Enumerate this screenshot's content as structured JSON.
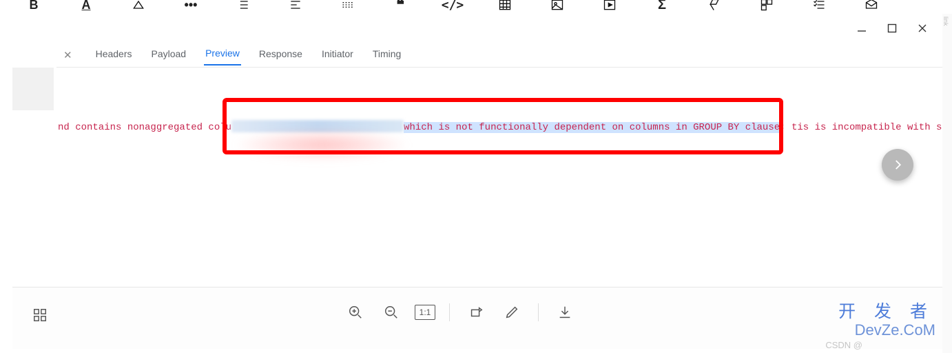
{
  "editor_toolbar": {
    "items": [
      "B",
      "A",
      "highlight",
      "more",
      "list",
      "align",
      "hr",
      "quote",
      "code",
      "table",
      "image",
      "video",
      "sigma",
      "eraser",
      "component",
      "checklist",
      "inbox"
    ]
  },
  "window_controls": {
    "minimize_title": "Minimize",
    "maximize_title": "Maximize",
    "close_title": "Close"
  },
  "devtools": {
    "tabs": [
      "Headers",
      "Payload",
      "Preview",
      "Response",
      "Initiator",
      "Timing"
    ],
    "active_tab": "Preview"
  },
  "error": {
    "prefix": "nd contains nonaggregated colu",
    "highlighted": "which is not functionally dependent on columns in GROUP BY clause",
    "suffix1": "; t",
    "suffix2": "is is incompatible with sql_"
  },
  "viewer_controls": {
    "grid_title": "Thumbnails",
    "zoom_in_title": "Zoom in",
    "zoom_out_title": "Zoom out",
    "actual_size_label": "1:1",
    "rotate_title": "Rotate",
    "edit_title": "Edit",
    "download_title": "Download"
  },
  "nav": {
    "next_title": "Next"
  },
  "watermarks": {
    "cn": "开 发 者",
    "en": "DevZe.CoM",
    "csdn": "CSDN @"
  }
}
